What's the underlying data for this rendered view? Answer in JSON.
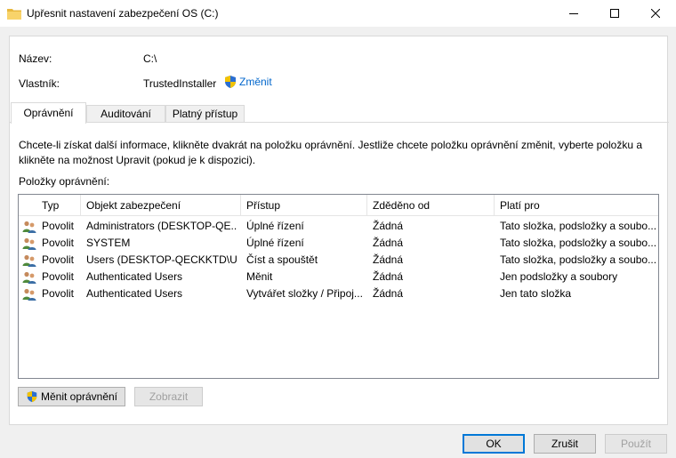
{
  "window": {
    "title": "Upřesnit nastavení zabezpečení OS (C:)"
  },
  "info": {
    "name_label": "Název:",
    "name_value": "C:\\",
    "owner_label": "Vlastník:",
    "owner_value": "TrustedInstaller",
    "change_link": "Změnit"
  },
  "tabs": [
    {
      "label": "Oprávnění",
      "active": true
    },
    {
      "label": "Auditování",
      "active": false
    },
    {
      "label": "Platný přístup",
      "active": false
    }
  ],
  "description": "Chcete-li získat další informace, klikněte dvakrát na položku oprávnění. Jestliže chcete položku oprávnění změnit, vyberte položku a klikněte na možnost Upravit (pokud je k dispozici).",
  "permissions": {
    "label": "Položky oprávnění:",
    "columns": [
      "Typ",
      "Objekt zabezpečení",
      "Přístup",
      "Zděděno od",
      "Platí pro"
    ],
    "rows": [
      [
        "Povolit",
        "Administrators (DESKTOP-QE...",
        "Úplné řízení",
        "Žádná",
        "Tato složka, podsložky a soubo..."
      ],
      [
        "Povolit",
        "SYSTEM",
        "Úplné řízení",
        "Žádná",
        "Tato složka, podsložky a soubo..."
      ],
      [
        "Povolit",
        "Users (DESKTOP-QECKKTD\\U...",
        "Číst a spouštět",
        "Žádná",
        "Tato složka, podsložky a soubo..."
      ],
      [
        "Povolit",
        "Authenticated Users",
        "Měnit",
        "Žádná",
        "Jen podsložky a soubory"
      ],
      [
        "Povolit",
        "Authenticated Users",
        "Vytvářet složky / Připoj...",
        "Žádná",
        "Jen tato složka"
      ]
    ]
  },
  "buttons": {
    "change_permissions": "Měnit oprávnění",
    "view": "Zobrazit",
    "ok": "OK",
    "cancel": "Zrušit",
    "apply": "Použít"
  },
  "colors": {
    "link": "#0066cc",
    "accent": "#0078d7"
  }
}
